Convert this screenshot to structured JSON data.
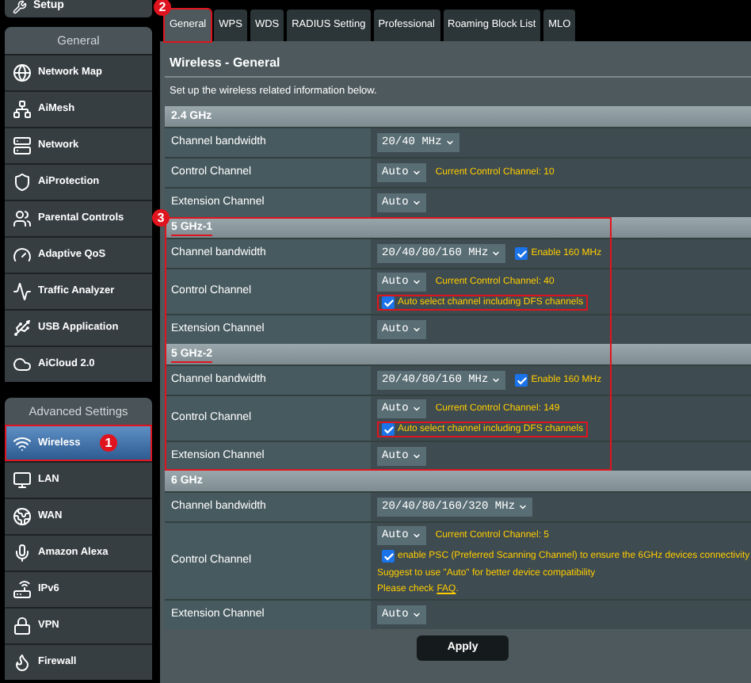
{
  "sidebar": {
    "top_item": {
      "label": "Setup"
    },
    "groups": [
      {
        "title": "General",
        "items": [
          {
            "label": "Network Map",
            "selected": false
          },
          {
            "label": "AiMesh",
            "selected": false
          },
          {
            "label": "Network",
            "selected": false
          },
          {
            "label": "AiProtection",
            "selected": false
          },
          {
            "label": "Parental Controls",
            "selected": false
          },
          {
            "label": "Adaptive QoS",
            "selected": false
          },
          {
            "label": "Traffic Analyzer",
            "selected": false
          },
          {
            "label": "USB Application",
            "selected": false
          },
          {
            "label": "AiCloud 2.0",
            "selected": false
          }
        ]
      },
      {
        "title": "Advanced Settings",
        "items": [
          {
            "label": "Wireless",
            "selected": true,
            "highlighted": true,
            "annotation": "1"
          },
          {
            "label": "LAN",
            "selected": false
          },
          {
            "label": "WAN",
            "selected": false
          },
          {
            "label": "Amazon Alexa",
            "selected": false
          },
          {
            "label": "IPv6",
            "selected": false
          },
          {
            "label": "VPN",
            "selected": false
          },
          {
            "label": "Firewall",
            "selected": false
          }
        ]
      }
    ]
  },
  "tabs": [
    {
      "label": "General",
      "selected": true,
      "highlighted": true,
      "annotation": "2"
    },
    {
      "label": "WPS",
      "selected": false
    },
    {
      "label": "WDS",
      "selected": false
    },
    {
      "label": "RADIUS Setting",
      "selected": false
    },
    {
      "label": "Professional",
      "selected": false
    },
    {
      "label": "Roaming Block List",
      "selected": false
    },
    {
      "label": "MLO",
      "selected": false
    }
  ],
  "page": {
    "title": "Wireless - General",
    "description": "Set up the wireless related information below."
  },
  "section_groups": [
    {
      "highlighted": false,
      "sections": [
        {
          "title": "2.4 GHz",
          "underlined": false,
          "rows": [
            {
              "label": "Channel bandwidth",
              "select": "20/40 MHz"
            },
            {
              "label": "Control Channel",
              "select": "Auto",
              "inline": {
                "kind": "note",
                "text": "Current Control Channel: 10"
              }
            },
            {
              "label": "Extension Channel",
              "select": "Auto"
            }
          ]
        }
      ]
    },
    {
      "highlighted": true,
      "annotation": "3",
      "sections": [
        {
          "title": "5 GHz-1",
          "underlined": true,
          "rows": [
            {
              "label": "Channel bandwidth",
              "select": "20/40/80/160 MHz",
              "inline": {
                "kind": "checkbox",
                "checked": true,
                "text": "Enable 160 MHz"
              }
            },
            {
              "label": "Control Channel",
              "select": "Auto",
              "inline": {
                "kind": "note",
                "text": "Current Control Channel: 40"
              },
              "lines": [
                {
                  "kind": "checkbox",
                  "checked": true,
                  "highlighted": true,
                  "text": "Auto select channel including DFS channels"
                }
              ]
            },
            {
              "label": "Extension Channel",
              "select": "Auto"
            }
          ]
        },
        {
          "title": "5 GHz-2",
          "underlined": true,
          "rows": [
            {
              "label": "Channel bandwidth",
              "select": "20/40/80/160 MHz",
              "inline": {
                "kind": "checkbox",
                "checked": true,
                "text": "Enable 160 MHz"
              }
            },
            {
              "label": "Control Channel",
              "select": "Auto",
              "inline": {
                "kind": "note",
                "text": "Current Control Channel: 149"
              },
              "lines": [
                {
                  "kind": "checkbox",
                  "checked": true,
                  "highlighted": true,
                  "text": "Auto select channel including DFS channels"
                }
              ]
            },
            {
              "label": "Extension Channel",
              "select": "Auto"
            }
          ]
        }
      ]
    },
    {
      "highlighted": false,
      "sections": [
        {
          "title": "6 GHz",
          "underlined": false,
          "rows": [
            {
              "label": "Channel bandwidth",
              "select": "20/40/80/160/320 MHz"
            },
            {
              "label": "Control Channel",
              "select": "Auto",
              "inline": {
                "kind": "note",
                "text": "Current Control Channel: 5"
              },
              "lines": [
                {
                  "kind": "checkbox",
                  "checked": true,
                  "highlighted": false,
                  "text": "enable PSC (Preferred Scanning Channel) to ensure the 6GHz devices connectivity"
                },
                {
                  "kind": "note",
                  "text": "Suggest to use \"Auto\" for better device compatibility"
                },
                {
                  "kind": "link",
                  "text": "Please check",
                  "link": "FAQ",
                  "suffix": "."
                }
              ]
            },
            {
              "label": "Extension Channel",
              "select": "Auto"
            }
          ]
        }
      ]
    }
  ],
  "apply_button": {
    "label": "Apply"
  }
}
